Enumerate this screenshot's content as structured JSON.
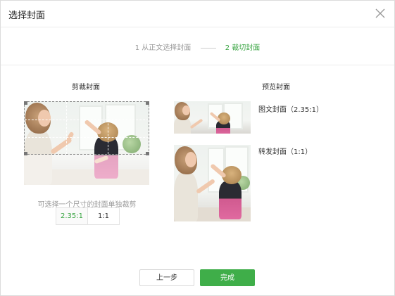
{
  "dialog": {
    "title": "选择封面",
    "close_icon": "close-icon"
  },
  "steps": {
    "step1": "1 从正文选择封面",
    "step2": "2 裁切封面",
    "accent_color": "#3aa543"
  },
  "crop": {
    "title": "剪裁封面",
    "hint": "可选择一个尺寸的封面单独裁剪",
    "ratio_options": [
      "2.35:1",
      "1:1"
    ],
    "selected_ratio": "2.35:1"
  },
  "preview": {
    "title": "预览封面",
    "items": [
      {
        "label": "图文封面（2.35:1）"
      },
      {
        "label": "转发封面（1:1）"
      }
    ]
  },
  "footer": {
    "prev_label": "上一步",
    "done_label": "完成",
    "done_color": "#3fae49"
  }
}
